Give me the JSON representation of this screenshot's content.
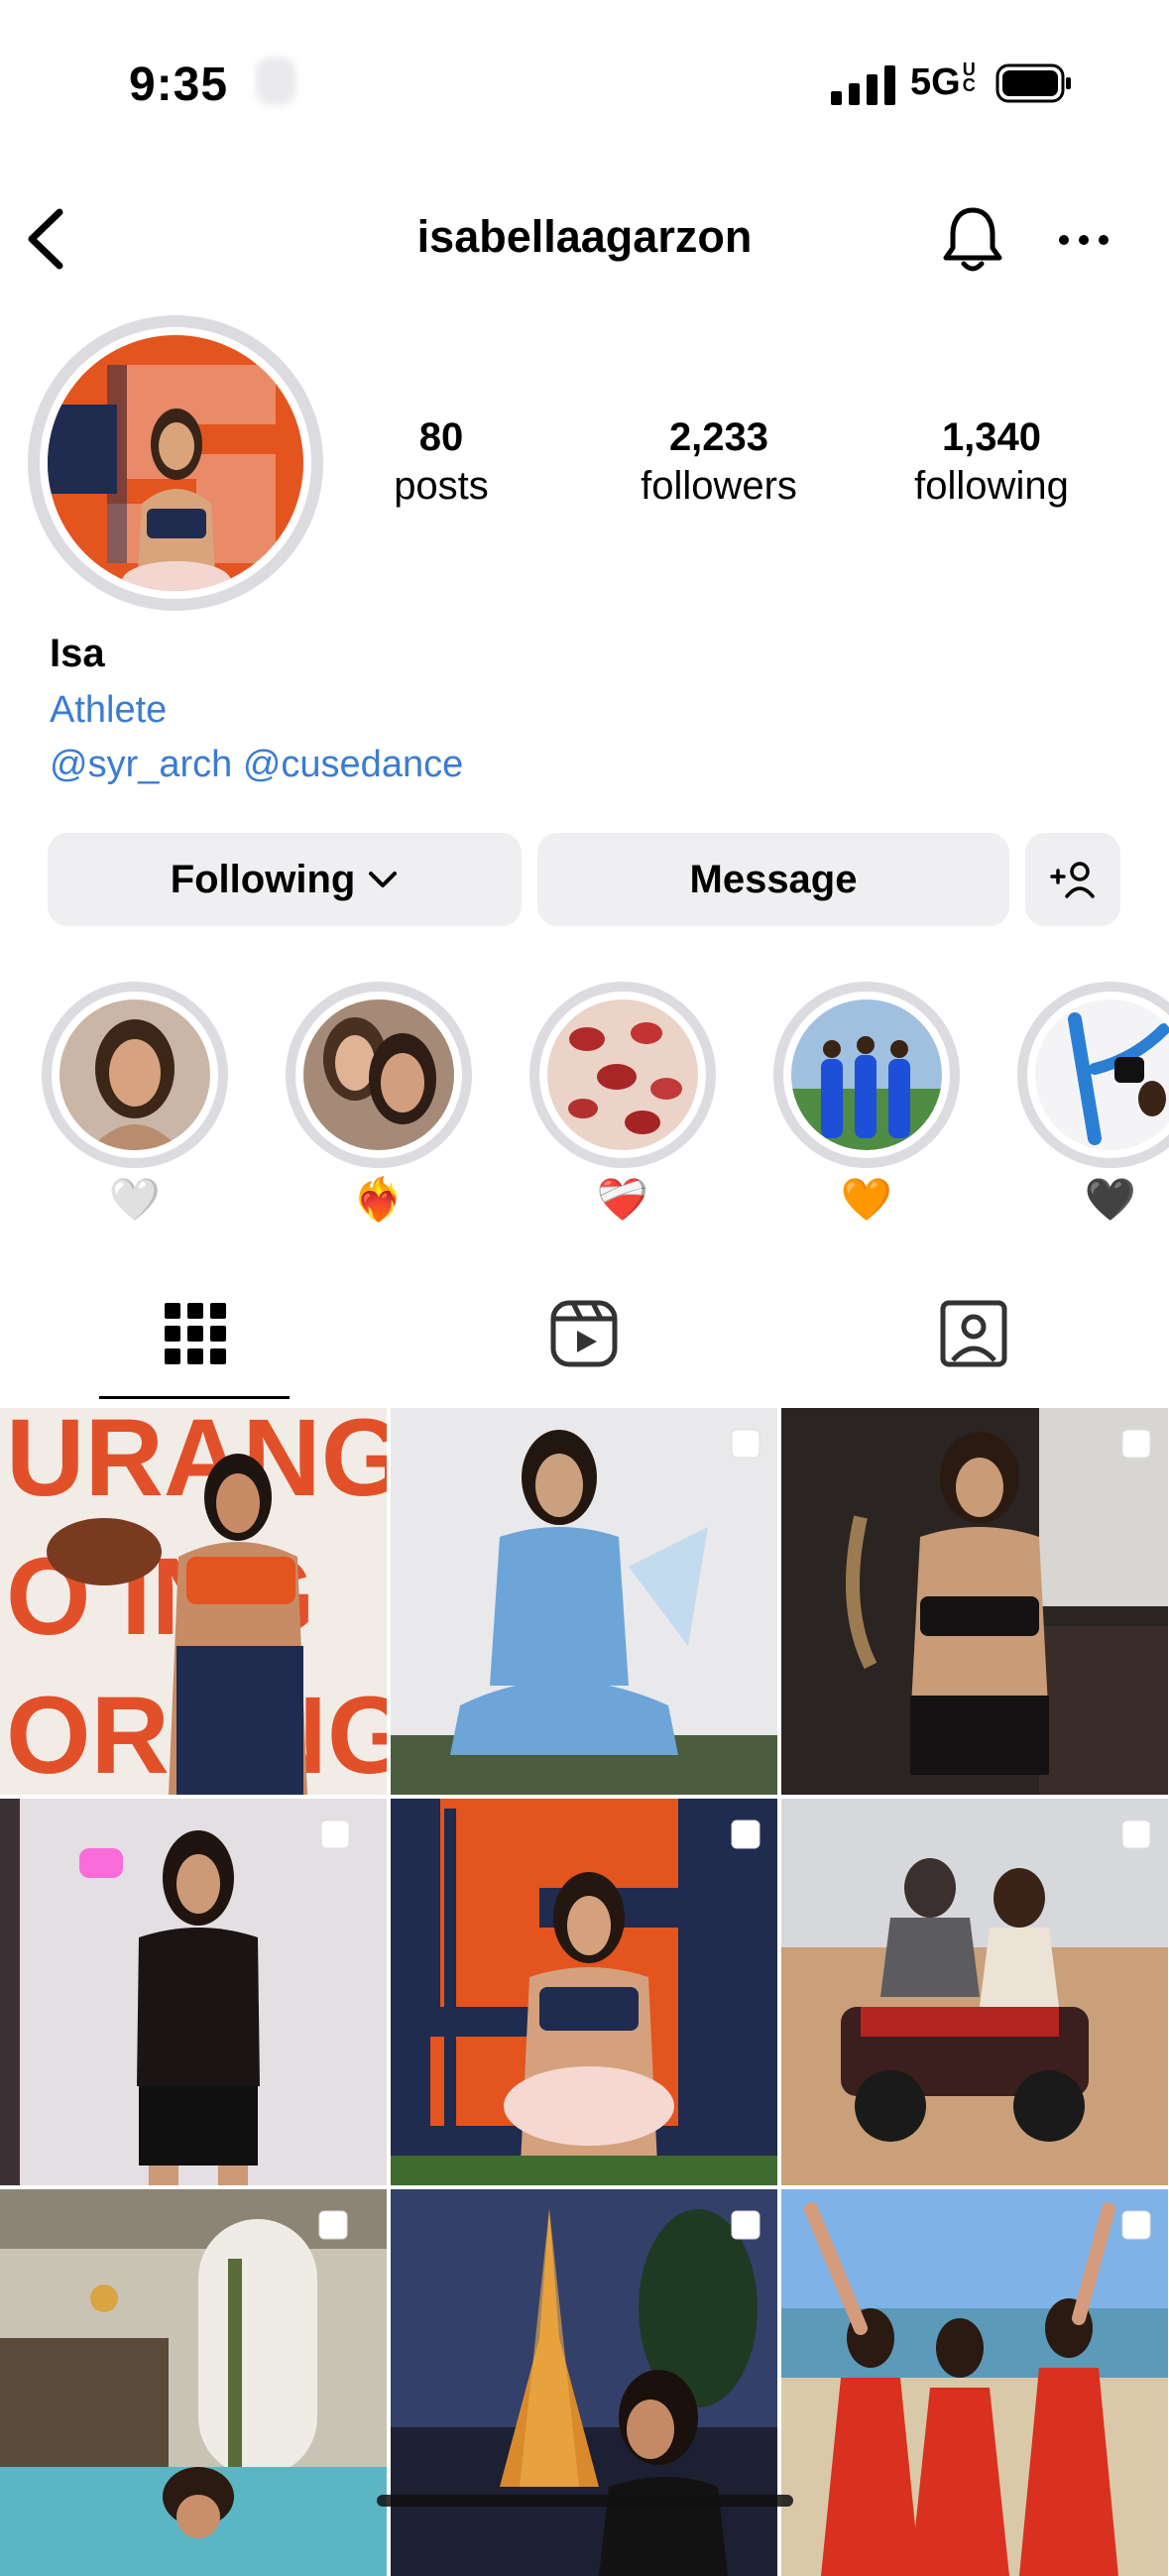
{
  "status": {
    "time": "9:35",
    "network": "5G",
    "network_badge": "UC"
  },
  "header": {
    "username": "isabellaagarzon",
    "back_icon": "chevron-left-icon",
    "bell_icon": "bell-icon",
    "more_icon": "more-horizontal-icon"
  },
  "stats": [
    {
      "value": "80",
      "label": "posts"
    },
    {
      "value": "2,233",
      "label": "followers"
    },
    {
      "value": "1,340",
      "label": "following"
    }
  ],
  "bio": {
    "name": "Isa",
    "category": "Athlete",
    "links": "@syr_arch @cusedance"
  },
  "actions": {
    "following": "Following",
    "message": "Message",
    "add_friend_icon": "add-person-icon"
  },
  "highlights": [
    {
      "label": "🤍"
    },
    {
      "label": "❤️‍🔥"
    },
    {
      "label": "❤️‍🩹"
    },
    {
      "label": "🧡"
    },
    {
      "label": "🖤"
    }
  ],
  "tabs": [
    {
      "name": "posts",
      "icon": "grid-icon",
      "selected": true
    },
    {
      "name": "reels",
      "icon": "reels-icon",
      "selected": false
    },
    {
      "name": "tagged",
      "icon": "tagged-icon",
      "selected": false
    }
  ],
  "colors": {
    "link": "#3b7cd3",
    "button_bg": "#efeff2",
    "syracuse_orange": "#e3541e",
    "syracuse_navy": "#1f2b4f"
  }
}
